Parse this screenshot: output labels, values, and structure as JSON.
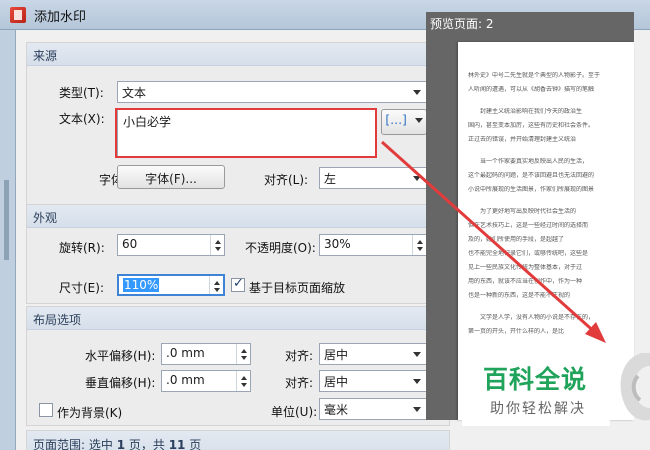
{
  "window": {
    "title": "添加水印"
  },
  "source": {
    "heading": "来源",
    "type_label": "类型(T):",
    "type_value": "文本",
    "text_label": "文本(X):",
    "text_value": "小白必学",
    "insert_field_icon": "[…]",
    "font_label": "字体(F):",
    "font_button": "字体(F)...",
    "align_label": "对齐(L):",
    "align_value": "左"
  },
  "appearance": {
    "heading": "外观",
    "rotation_label": "旋转(R):",
    "rotation_value": "60",
    "opacity_label": "不透明度(O):",
    "opacity_value": "30%",
    "size_label": "尺寸(E):",
    "size_value": "110%",
    "scale_checkbox_label": "基于目标页面缩放",
    "scale_checked": true
  },
  "layout": {
    "heading": "布局选项",
    "h_offset_label": "水平偏移(H):",
    "h_offset_value": ".0 mm",
    "h_align_label": "对齐:",
    "h_align_value": "居中",
    "v_offset_label": "垂直偏移(H):",
    "v_offset_value": ".0 mm",
    "v_align_label": "对齐:",
    "v_align_value": "居中",
    "background_label": "作为背景(K)",
    "background_checked": false,
    "unit_label": "单位(U):",
    "unit_value": "毫米"
  },
  "page_range": {
    "prefix": "页面范围: 选中 ",
    "selected": "1",
    "middle": " 页，共 ",
    "total": "11",
    "suffix": " 页"
  },
  "preview": {
    "heading": "预览页面: 2",
    "page_text": [
      "林外史》中号二先生就是个典型的人物影子。至于",
      "人听闻的遭遇，可以从《胡香去钟》描写的笔触",
      "封建主义统治影响在我们今天的政治生",
      "国内，甚至变本加厉，这些有历史和社会条件。",
      "正过去的错误，并开始清理封建主义统治",
      "当一个作家要真实地反映出人民的生活，",
      "这个最起码的问题，是不该回避且也无法回避的",
      "小说中所展现的生活图景，作家们所展现的图景",
      "为了更好地写出反映时代社会生活的",
      "但在艺术技巧上，这是一些经过时间的选择而",
      "及的，她们所使用的手段，是超越了",
      "也不能完全地记录它们，或够传统吧，这些是",
      "见上一些民族文化传统为整体基本，对于过",
      "用的东西，就该不应当在创作中，作为一种",
      "也是一种新的东西，这是不能不正视的",
      "文学是人学，没有人物的小说是不存在的，",
      "第一页的开头，开什么样的人，是比"
    ]
  },
  "watermark": {
    "brand": "百科全说",
    "slogan": "助你轻松解决"
  },
  "colors": {
    "annotation_red": "#e23b3b",
    "watermark_green": "#20a35a",
    "title_blue": "#2b3f5c"
  }
}
